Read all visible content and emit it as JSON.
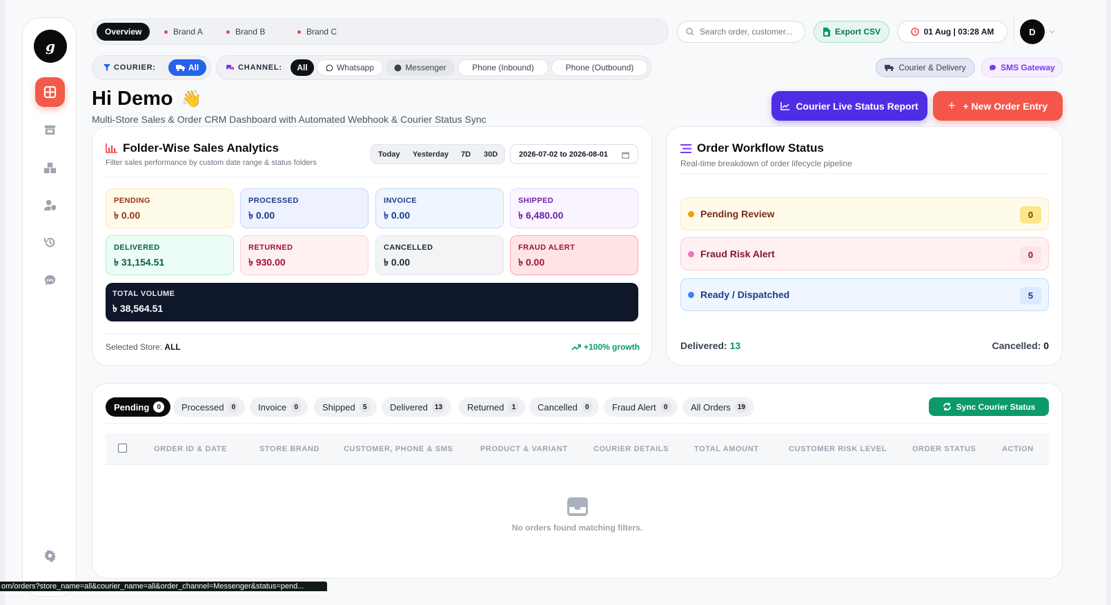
{
  "sidebar": {
    "logo_letter": "g",
    "items": [
      {
        "icon": "dashboard-grid-icon"
      },
      {
        "icon": "store-icon"
      },
      {
        "icon": "boxes-icon"
      },
      {
        "icon": "user-shield-icon"
      },
      {
        "icon": "history-icon"
      },
      {
        "icon": "sms-chat-icon"
      },
      {
        "icon": "settings-gear-icon"
      }
    ]
  },
  "top_tabs": [
    "Overview",
    "Brand A",
    "Brand B",
    "Brand C"
  ],
  "search": {
    "placeholder": "Search order, customer..."
  },
  "export_label": "Export CSV",
  "datetime": "01 Aug | 03:28 AM",
  "avatar_letter": "D",
  "courier_filter": {
    "label": "COURIER:",
    "value": "All"
  },
  "channel_filter": {
    "label": "CHANNEL:",
    "options": [
      "All",
      "Whatsapp",
      "Messenger",
      "Phone (Inbound)",
      "Phone (Outbound)"
    ]
  },
  "courier_delivery_label": "Courier & Delivery",
  "sms_gateway_label": "SMS Gateway",
  "greeting": "Hi Demo",
  "greeting_emoji": "👋",
  "subtitle": "Multi-Store Sales & Order CRM Dashboard with Automated Webhook & Courier Status Sync",
  "live_report_label": "Courier Live Status Report",
  "new_order_label": "+ New Order Entry",
  "sales": {
    "title": "Folder-Wise Sales Analytics",
    "subtitle": "Filter sales performance by custom date range & status folders",
    "ranges": [
      "Today",
      "Yesterday",
      "7D",
      "30D"
    ],
    "date_range": "2026-07-02 to 2026-08-01",
    "stats": [
      {
        "label": "PENDING",
        "value": "৳ 0.00",
        "color": "#9a3412",
        "bg": "#fffbeb",
        "border": "#fde9b8"
      },
      {
        "label": "PROCESSED",
        "value": "৳ 0.00",
        "color": "#1e3a8a",
        "bg": "#eef2ff",
        "border": "#c7d2fe"
      },
      {
        "label": "INVOICE",
        "value": "৳ 0.00",
        "color": "#1e3a8a",
        "bg": "#eff6ff",
        "border": "#bfdbfe"
      },
      {
        "label": "SHIPPED",
        "value": "৳ 6,480.00",
        "color": "#6b21a8",
        "bg": "#faf5ff",
        "border": "#e9d5ff"
      },
      {
        "label": "DELIVERED",
        "value": "৳ 31,154.51",
        "color": "#065f46",
        "bg": "#ecfdf5",
        "border": "#a7f3d0"
      },
      {
        "label": "RETURNED",
        "value": "৳ 930.00",
        "color": "#9f1239",
        "bg": "#fff1f2",
        "border": "#fecdd3"
      },
      {
        "label": "CANCELLED",
        "value": "৳ 0.00",
        "color": "#1f2937",
        "bg": "#f3f4f6",
        "border": "#e5e7eb"
      },
      {
        "label": "FRAUD ALERT",
        "value": "৳ 0.00",
        "color": "#9f1239",
        "bg": "#ffe4e6",
        "border": "#fda4af"
      }
    ],
    "total": {
      "label": "TOTAL VOLUME",
      "value": "৳ 38,564.51"
    },
    "selected_store_label": "Selected Store:",
    "selected_store_value": "ALL",
    "growth": "+100% growth"
  },
  "workflow": {
    "title": "Order Workflow Status",
    "subtitle": "Real-time breakdown of order lifecycle pipeline",
    "rows": [
      {
        "label": "Pending Review",
        "count": "0",
        "dot": "#f59e0b",
        "bg": "#fffbeb",
        "border": "#fde9b8",
        "text": "#7c2d12",
        "badge_bg": "#fde68a",
        "badge_text": "#78350f"
      },
      {
        "label": "Fraud Risk Alert",
        "count": "0",
        "dot": "#f472b6",
        "bg": "#fff1f2",
        "border": "#fecdd3",
        "text": "#881337",
        "badge_bg": "#ffe4e6",
        "badge_text": "#881337"
      },
      {
        "label": "Ready / Dispatched",
        "count": "5",
        "dot": "#3b82f6",
        "bg": "#eff6ff",
        "border": "#bfdbfe",
        "text": "#1e3a8a",
        "badge_bg": "#dbeafe",
        "badge_text": "#1e3a8a"
      }
    ],
    "delivered_label": "Delivered:",
    "delivered_value": "13",
    "cancelled_label": "Cancelled:",
    "cancelled_value": "0"
  },
  "order_tabs": [
    {
      "label": "Pending",
      "count": "0"
    },
    {
      "label": "Processed",
      "count": "0"
    },
    {
      "label": "Invoice",
      "count": "0"
    },
    {
      "label": "Shipped",
      "count": "5"
    },
    {
      "label": "Delivered",
      "count": "13"
    },
    {
      "label": "Returned",
      "count": "1"
    },
    {
      "label": "Cancelled",
      "count": "0"
    },
    {
      "label": "Fraud Alert",
      "count": "0"
    },
    {
      "label": "All Orders",
      "count": "19"
    }
  ],
  "sync_label": "Sync Courier Status",
  "table": {
    "columns": [
      "ORDER ID & DATE",
      "STORE BRAND",
      "CUSTOMER, PHONE & SMS",
      "PRODUCT & VARIANT",
      "COURIER DETAILS",
      "TOTAL AMOUNT",
      "CUSTOMER RISK LEVEL",
      "ORDER STATUS",
      "ACTION"
    ],
    "empty_text": "No orders found matching filters."
  },
  "status_url": "om/orders?store_name=all&courier_name=all&order_channel=Messenger&status=pend..."
}
